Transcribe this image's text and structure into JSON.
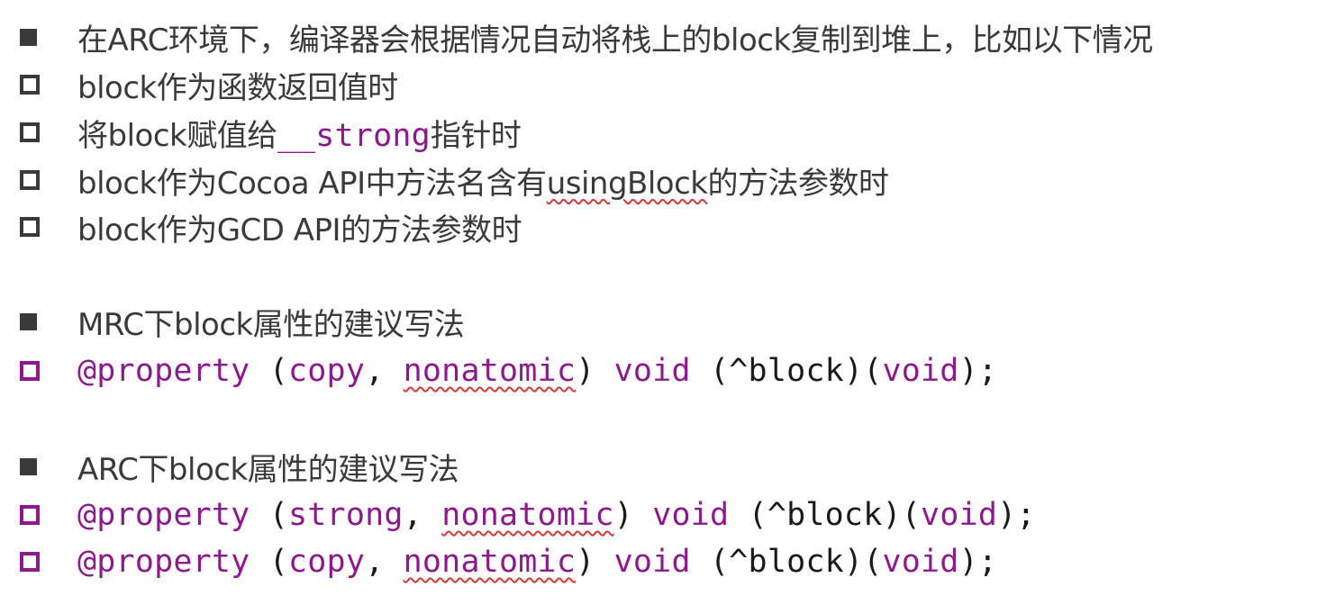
{
  "arc_auto_copy": {
    "heading": "在ARC环境下，编译器会根据情况自动将栈上的block复制到堆上，比如以下情况",
    "items": {
      "return_value": "block作为函数返回值时",
      "strong_prefix": "将block赋值给",
      "strong_keyword": "__strong",
      "strong_suffix": "指针时",
      "cocoa_prefix": "block作为Cocoa API中方法名含有",
      "cocoa_keyword": "usingBlock",
      "cocoa_suffix": "的方法参数时",
      "gcd": "block作为GCD API的方法参数时"
    }
  },
  "mrc_section": {
    "heading": "MRC下block属性的建议写法",
    "code": {
      "at_property": "@property",
      "open_paren": " (",
      "attr1": "copy",
      "comma": ", ",
      "attr2": "nonatomic",
      "close_paren": ") ",
      "type": "void",
      "space": " ",
      "block_decl": "(^block)(",
      "param_type": "void",
      "end": ");"
    }
  },
  "arc_section": {
    "heading": "ARC下block属性的建议写法",
    "code_strong": {
      "at_property": "@property",
      "open_paren": " (",
      "attr1": "strong",
      "comma": ", ",
      "attr2": "nonatomic",
      "close_paren": ") ",
      "type": "void",
      "space": " ",
      "block_decl": "(^block)(",
      "param_type": "void",
      "end": ");"
    },
    "code_copy": {
      "at_property": "@property",
      "open_paren": " (",
      "attr1": "copy",
      "comma": ", ",
      "attr2": "nonatomic",
      "close_paren": ") ",
      "type": "void",
      "space": " ",
      "block_decl": "(^block)(",
      "param_type": "void",
      "end": ");"
    }
  },
  "colors": {
    "text": "#3a3a3a",
    "keyword": "#8c1a8c",
    "spellcheck": "#d23a3a"
  },
  "icons": {
    "section_bullet": "filled-square-bullet",
    "item_bullet": "hollow-square-bullet"
  }
}
